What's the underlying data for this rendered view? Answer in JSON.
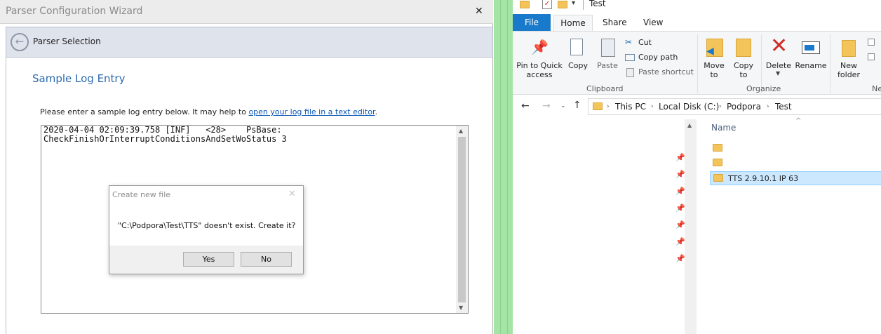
{
  "wizard": {
    "title": "Parser Configuration Wizard",
    "close": "✕",
    "band_label": "Parser Selection",
    "heading": "Sample Log Entry",
    "instruction_prefix": "Please enter a sample log entry below.  It may help to ",
    "instruction_link": "open your log file in a text editor",
    "instruction_suffix": ".",
    "log_text": "2020-04-04 02:09:39.758 [INF]   <28>    PsBase:\nCheckFinishOrInterruptConditionsAndSetWoStatus 3"
  },
  "dialog": {
    "title": "Create new file",
    "message": "\"C:\\Podpora\\Test\\TTS\" doesn't exist. Create it?",
    "yes_label": "Yes",
    "no_label": "No"
  },
  "explorer": {
    "window_title": "Test",
    "tabs": {
      "file": "File",
      "home": "Home",
      "share": "Share",
      "view": "View"
    },
    "ribbon": {
      "pin_label_1": "Pin to Quick",
      "pin_label_2": "access",
      "copy_label": "Copy",
      "paste_label": "Paste",
      "cut_label": "Cut",
      "copy_path_label": "Copy path",
      "paste_shortcut_label": "Paste shortcut",
      "move_to_label_1": "Move",
      "move_to_label_2": "to",
      "copy_to_label_1": "Copy",
      "copy_to_label_2": "to",
      "delete_label": "Delete",
      "rename_label": "Rename",
      "new_folder_label_1": "New",
      "new_folder_label_2": "folder",
      "clipboard_group": "Clipboard",
      "organize_group": "Organize",
      "new_group": "Ne"
    },
    "breadcrumb": [
      "This PC",
      "Local Disk (C:)",
      "Podpora",
      "Test"
    ],
    "column_name": "Name",
    "files": [
      "",
      "",
      "TTS 2.9.10.1 IP 63"
    ]
  },
  "colors": {
    "accent": "#1979ca",
    "heading": "#2d6bae",
    "link": "#0b57b8",
    "selection": "#cce8ff",
    "green": "#a4e4a4"
  }
}
